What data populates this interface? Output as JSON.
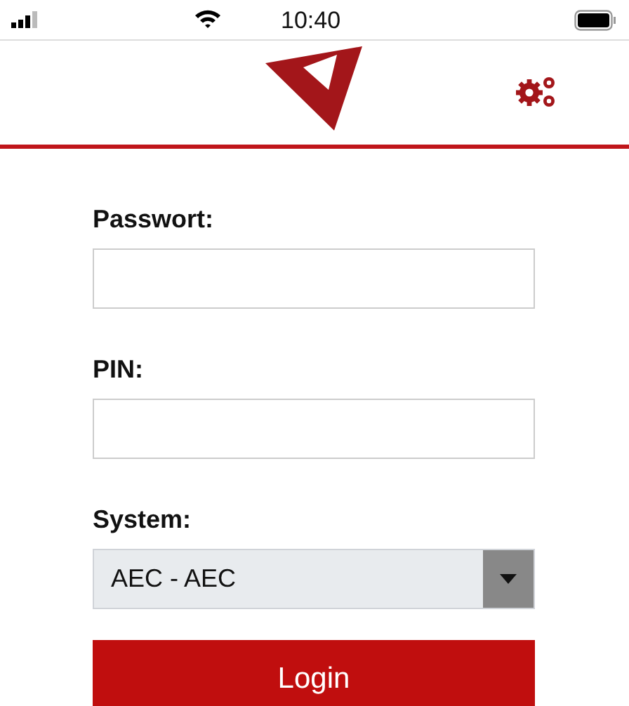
{
  "status_bar": {
    "time": "10:40"
  },
  "form": {
    "fields": [
      {
        "kind": "input",
        "label": "Passwort:"
      },
      {
        "kind": "input",
        "label": "PIN:"
      },
      {
        "kind": "select",
        "label": "System:",
        "value": "AEC - AEC"
      }
    ],
    "button": "Login"
  }
}
